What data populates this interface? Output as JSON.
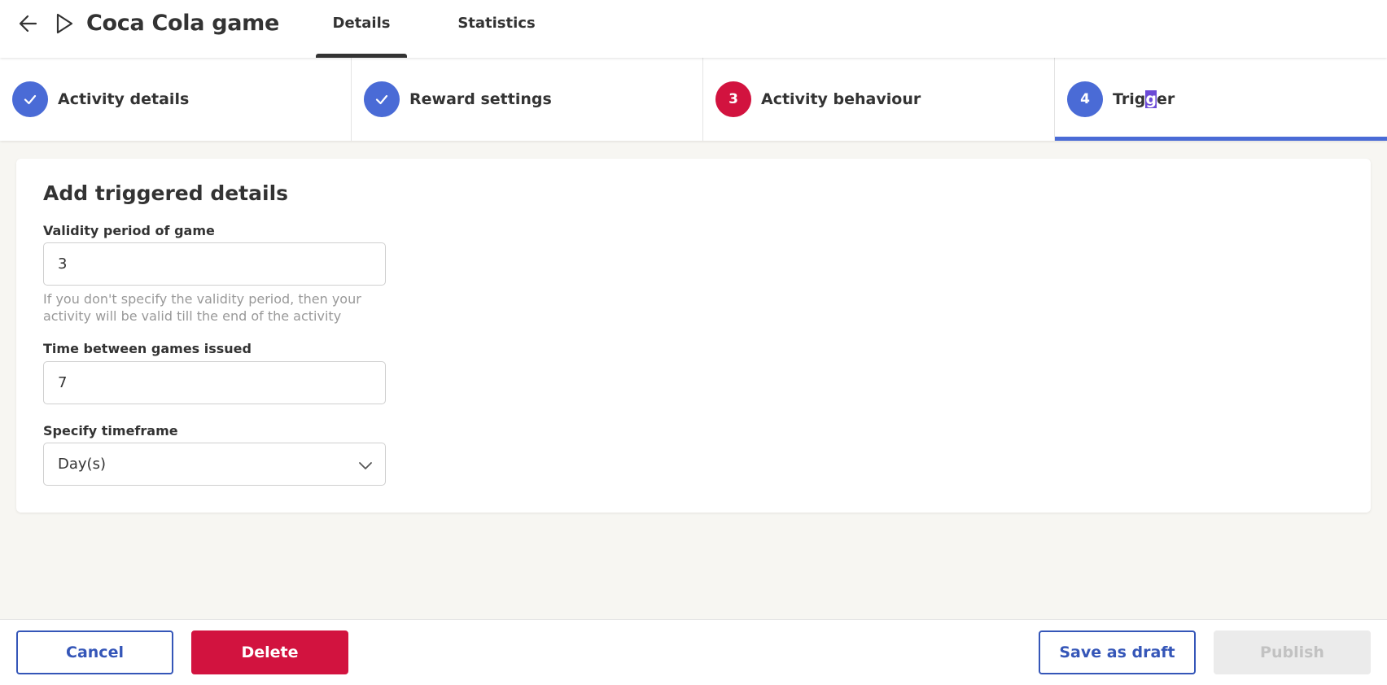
{
  "header": {
    "title": "Coca Cola game",
    "tabs": [
      {
        "label": "Details",
        "active": true
      },
      {
        "label": "Statistics",
        "active": false
      }
    ]
  },
  "stepper": {
    "steps": [
      {
        "label": "Activity details",
        "state": "done",
        "badge": ""
      },
      {
        "label": "Reward settings",
        "state": "done",
        "badge": ""
      },
      {
        "label": "Activity behaviour",
        "state": "error",
        "badge": "3"
      },
      {
        "label_prefix": "Trig",
        "label_highlight": "g",
        "label_suffix": "er",
        "state": "current",
        "badge": "4"
      }
    ]
  },
  "form": {
    "title": "Add triggered details",
    "validity": {
      "label": "Validity period of game",
      "value": "3",
      "help": "If you don't specify the validity period, then your activity will be valid till the end of the activity"
    },
    "time_between": {
      "label": "Time between games issued",
      "value": "7"
    },
    "timeframe": {
      "label": "Specify timeframe",
      "selected": "Day(s)"
    }
  },
  "footer": {
    "cancel_label": "Cancel",
    "delete_label": "Delete",
    "save_label": "Save as draft",
    "publish_label": "Publish"
  },
  "colors": {
    "accent": "#4a6bd6",
    "danger": "#d2133f",
    "outline": "#3556b8",
    "disabled_bg": "#ebebeb"
  }
}
